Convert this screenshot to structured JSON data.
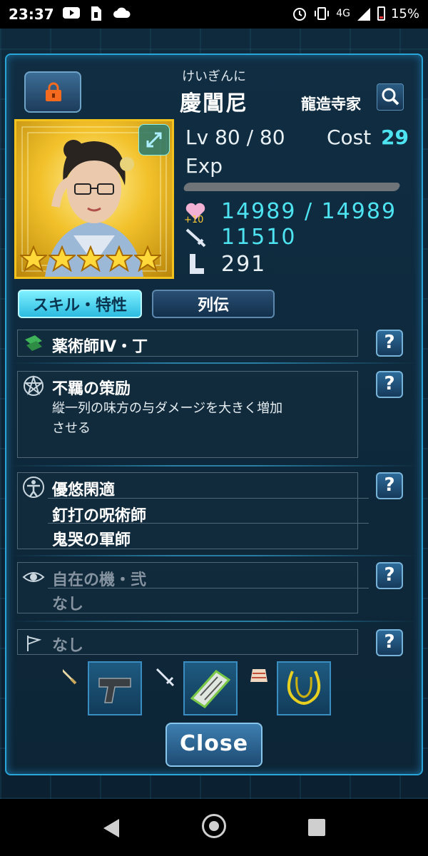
{
  "status_bar": {
    "time": "23:37",
    "network": "4G",
    "battery": "15%",
    "icons": [
      "youtube-icon",
      "sim-icon",
      "cloud-icon",
      "alarm-icon",
      "vibrate-icon",
      "signal-icon",
      "battery-icon"
    ]
  },
  "header": {
    "furigana": "けいぎんに",
    "name": "慶閶尼",
    "clan": "龍造寺家"
  },
  "stats": {
    "lv": "Lv 80 / 80",
    "cost_label": "Cost",
    "cost_value": "29",
    "exp_label": "Exp",
    "hp_badge": "+10",
    "hp": "14989 / 14989",
    "attack": "11510",
    "speed": "291",
    "rarity_stars": 5
  },
  "tabs": {
    "skill": "スキル・特性",
    "bio": "列伝"
  },
  "sections": {
    "passive": {
      "title": "薬術師Ⅳ・丁"
    },
    "active": {
      "title": "不羈の策励",
      "desc_line1": "縦一列の味方の与ダメージを大きく増加",
      "desc_line2": "させる"
    },
    "traits": {
      "t1": "優悠閑適",
      "t2": "釘打の呪術師",
      "t3": "鬼哭の軍師"
    },
    "awaken": {
      "title": "自在の機・弐",
      "value": "なし"
    },
    "flag": {
      "title": "なし"
    }
  },
  "help_label": "?",
  "close_label": "Close",
  "colors": {
    "accent": "#4ee3f0",
    "frame": "#2aa5d8",
    "gold": "#f3c21c"
  }
}
